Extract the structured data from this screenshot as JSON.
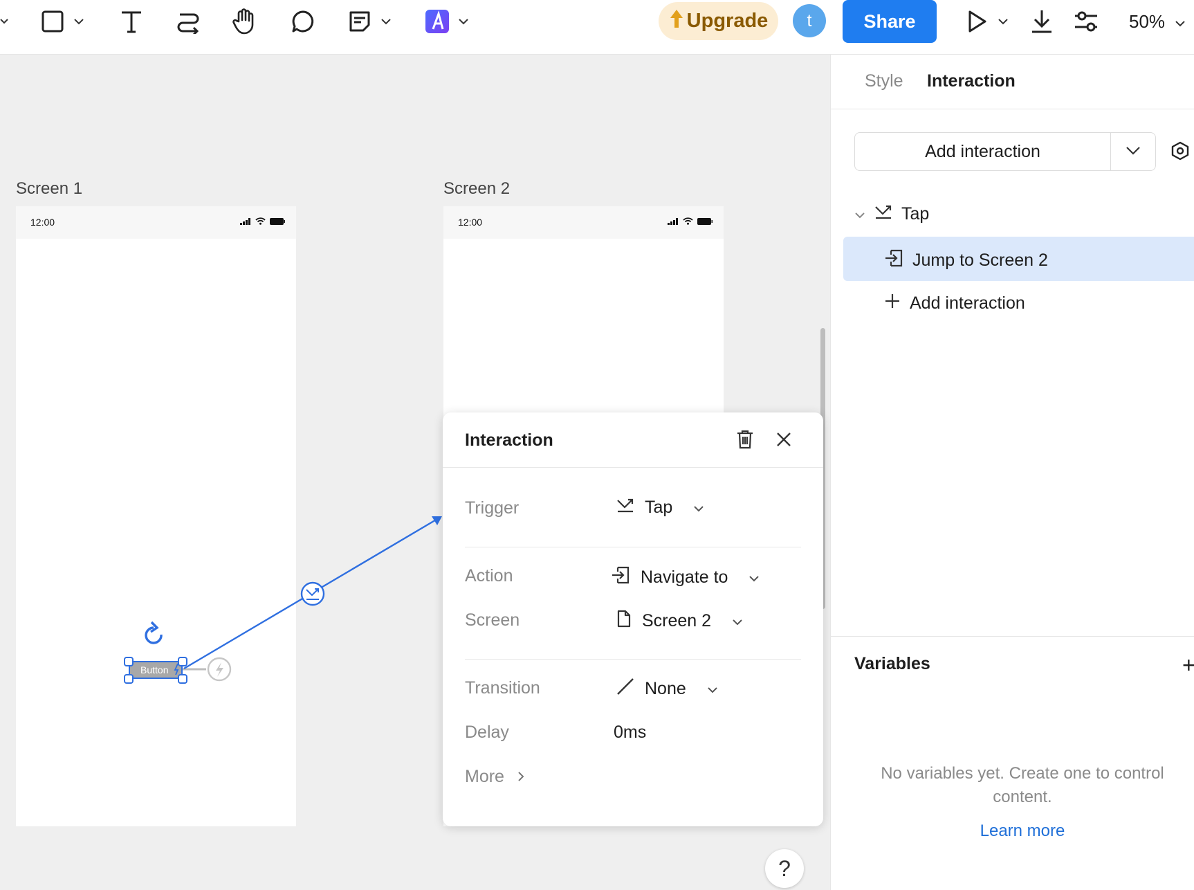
{
  "toolbar": {
    "upgrade_label": "Upgrade",
    "avatar_initial": "t",
    "share_label": "Share",
    "zoom_label": "50%"
  },
  "canvas": {
    "frames": [
      {
        "label": "Screen 1",
        "time": "12:00"
      },
      {
        "label": "Screen 2",
        "time": "12:00"
      }
    ],
    "button_label": "Button",
    "help_label": "?"
  },
  "popup": {
    "title": "Interaction",
    "trigger_label": "Trigger",
    "trigger_value": "Tap",
    "action_label": "Action",
    "action_value": "Navigate to",
    "screen_label": "Screen",
    "screen_value": "Screen 2",
    "transition_label": "Transition",
    "transition_value": "None",
    "delay_label": "Delay",
    "delay_value": "0ms",
    "more_label": "More"
  },
  "panel": {
    "tabs": [
      {
        "label": "Style",
        "active": false
      },
      {
        "label": "Interaction",
        "active": true
      }
    ],
    "add_interaction_label": "Add interaction",
    "tree": {
      "trigger": "Tap",
      "action": "Jump to Screen 2",
      "add_label": "Add interaction"
    },
    "variables": {
      "title": "Variables",
      "plus": "+",
      "empty_text": "No variables yet. Create one to control content.",
      "learn_more": "Learn more"
    }
  },
  "colors": {
    "accent": "#1f7df0",
    "selection": "#dbe8fb",
    "connector": "#2f6fe0",
    "upgrade_bg": "#fcedd3"
  }
}
